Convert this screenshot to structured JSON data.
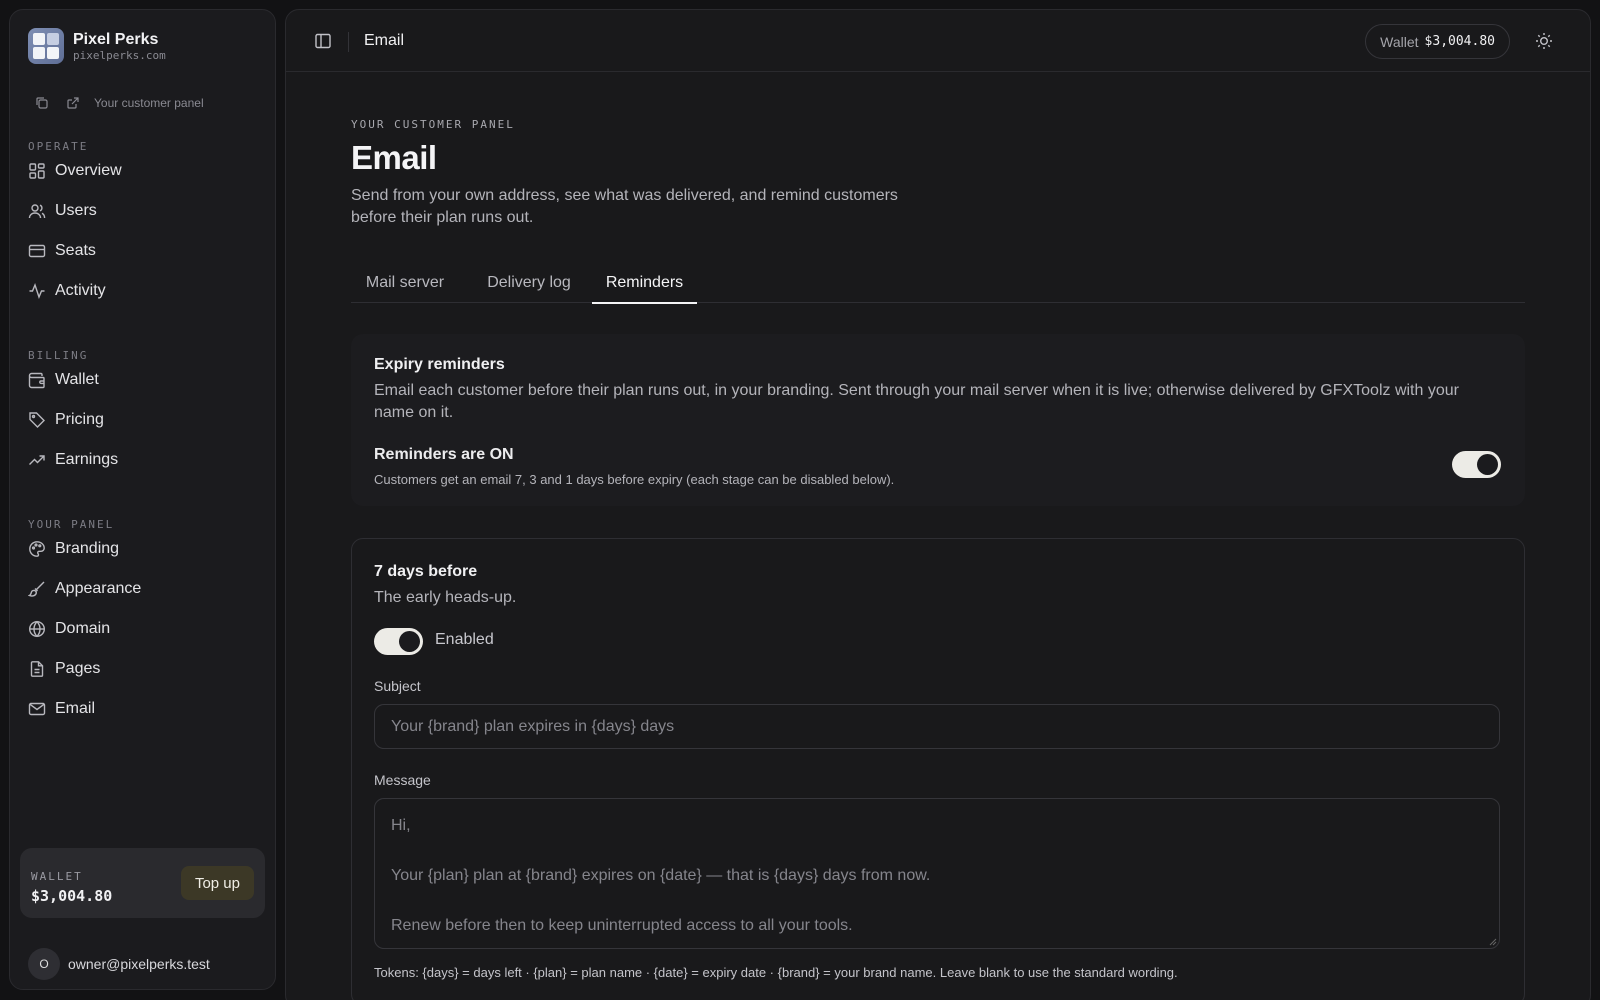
{
  "brand": {
    "name": "Pixel Perks",
    "domain": "pixelperks.com"
  },
  "quick_links": {
    "panel_label": "Your customer panel"
  },
  "sidebar": {
    "operate_label": "OPERATE",
    "billing_label": "BILLING",
    "panel_label": "YOUR PANEL",
    "operate": [
      {
        "label": "Overview",
        "icon": "grid-icon"
      },
      {
        "label": "Users",
        "icon": "users-icon"
      },
      {
        "label": "Seats",
        "icon": "card-icon"
      },
      {
        "label": "Activity",
        "icon": "activity-icon"
      }
    ],
    "billing": [
      {
        "label": "Wallet",
        "icon": "wallet-icon"
      },
      {
        "label": "Pricing",
        "icon": "tag-icon"
      },
      {
        "label": "Earnings",
        "icon": "trending-up-icon"
      }
    ],
    "panel": [
      {
        "label": "Branding",
        "icon": "palette-icon"
      },
      {
        "label": "Appearance",
        "icon": "brush-icon"
      },
      {
        "label": "Domain",
        "icon": "globe-icon"
      },
      {
        "label": "Pages",
        "icon": "file-icon"
      },
      {
        "label": "Email",
        "icon": "mail-icon"
      }
    ]
  },
  "wallet_card": {
    "label": "WALLET",
    "amount": "$3,004.80",
    "topup_label": "Top up"
  },
  "user": {
    "initial": "O",
    "email": "owner@pixelperks.test"
  },
  "topbar": {
    "title": "Email",
    "wallet_label": "Wallet",
    "wallet_value": "$3,004.80"
  },
  "page": {
    "eyebrow": "YOUR CUSTOMER PANEL",
    "title": "Email",
    "description": "Send from your own address, see what was delivered, and remind customers before their plan runs out."
  },
  "tabs": [
    {
      "label": "Mail server",
      "active": false
    },
    {
      "label": "Delivery log",
      "active": false
    },
    {
      "label": "Reminders",
      "active": true
    }
  ],
  "expiry": {
    "title": "Expiry reminders",
    "description": "Email each customer before their plan runs out, in your branding. Sent through your mail server when it is live; otherwise delivered by GFXToolz with your name on it.",
    "status_title": "Reminders are ON",
    "status_sub": "Customers get an email 7, 3 and 1 days before expiry (each stage can be disabled below).",
    "enabled": true
  },
  "stage": {
    "title": "7 days before",
    "description": "The early heads-up.",
    "enabled": true,
    "enabled_label": "Enabled",
    "subject_label": "Subject",
    "subject_placeholder": "Your {brand} plan expires in {days} days",
    "message_label": "Message",
    "message_lines": [
      "Hi,",
      "",
      "Your {plan} plan at {brand} expires on {date} — that is {days} days from now.",
      "",
      "Renew before then to keep uninterrupted access to all your tools."
    ],
    "tokens_help": "Tokens: {days} = days left · {plan} = plan name · {date} = expiry date · {brand} = your brand name. Leave blank to use the standard wording."
  },
  "colors": {
    "background": "#121214",
    "panel": "#19191b",
    "toggle_on": "#ecebe6",
    "topup_bg": "#3c3826"
  }
}
